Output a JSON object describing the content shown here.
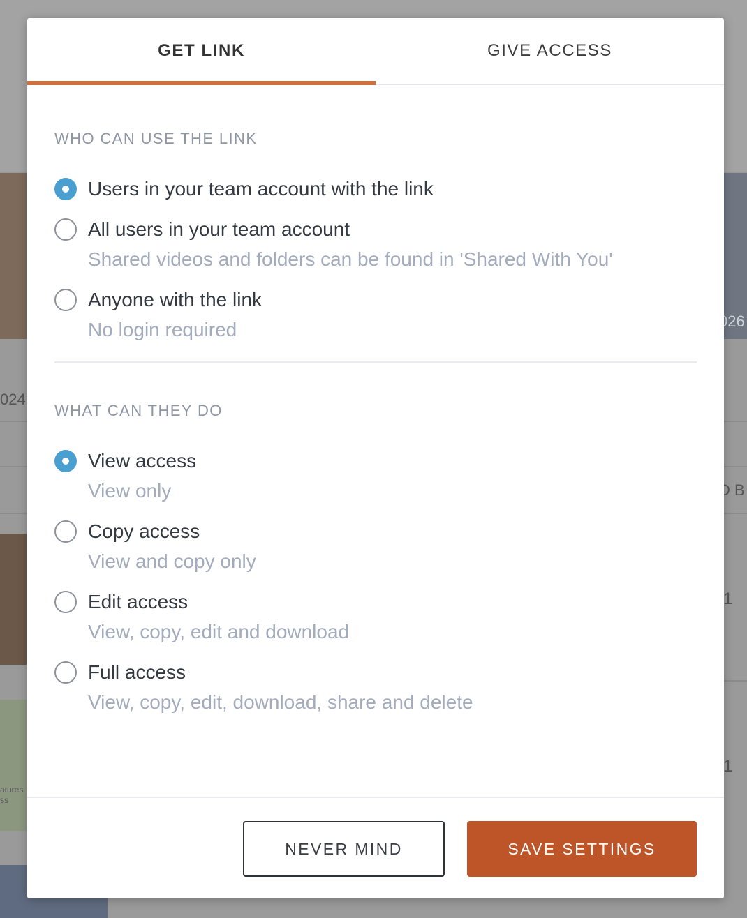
{
  "tabs": [
    {
      "label": "GET LINK",
      "active": true
    },
    {
      "label": "GIVE ACCESS",
      "active": false
    }
  ],
  "who_section": {
    "title": "WHO CAN USE THE LINK",
    "options": [
      {
        "label": "Users in your team account with the link",
        "description": "",
        "checked": true
      },
      {
        "label": "All users in your team account",
        "description": "Shared videos and folders can be found in 'Shared With You'",
        "checked": false
      },
      {
        "label": "Anyone with the link",
        "description": "No login required",
        "checked": false
      }
    ]
  },
  "what_section": {
    "title": "WHAT CAN THEY DO",
    "options": [
      {
        "label": "View access",
        "description": "View only",
        "checked": true
      },
      {
        "label": "Copy access",
        "description": "View and copy only",
        "checked": false
      },
      {
        "label": "Edit access",
        "description": "View, copy, edit and download",
        "checked": false
      },
      {
        "label": "Full access",
        "description": "View, copy, edit, download, share and delete",
        "checked": false
      }
    ]
  },
  "footer": {
    "cancel_label": "NEVER MIND",
    "save_label": "SAVE SETTINGS"
  },
  "background": {
    "fragments": [
      "026",
      "024",
      "D B",
      "1",
      "1",
      "atures",
      "ss"
    ]
  },
  "colors": {
    "accent": "#d0703d",
    "radio_checked": "#4a9fd1",
    "save_button": "#bd5529"
  }
}
